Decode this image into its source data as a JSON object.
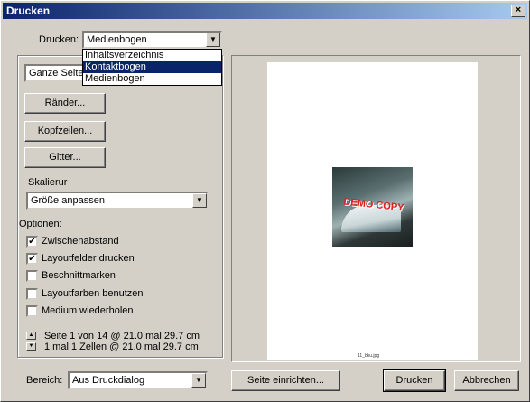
{
  "window": {
    "title": "Drucken",
    "close": "×"
  },
  "printer": {
    "label": "Drucken:",
    "value": "Medienbogen",
    "options": [
      "Inhaltsverzeichnis",
      "Kontaktbogen",
      "Medienbogen"
    ],
    "highlighted": "Kontaktbogen"
  },
  "page_mode": {
    "value": "Ganze Seite"
  },
  "buttons": {
    "margins": "Ränder...",
    "headers": "Kopfzeilen...",
    "grid": "Gitter...",
    "page_setup": "Seite einrichten...",
    "print": "Drucken",
    "cancel": "Abbrechen"
  },
  "scaling": {
    "label": "Skalierur",
    "value": "Größe anpassen"
  },
  "options": {
    "label": "Optionen:",
    "items": [
      {
        "label": "Zwischenabstand",
        "checked": true
      },
      {
        "label": "Layoutfelder drucken",
        "checked": true
      },
      {
        "label": "Beschnittmarken",
        "checked": false
      },
      {
        "label": "Layoutfarben benutzen",
        "checked": false
      },
      {
        "label": "Medium wiederholen",
        "checked": false
      }
    ]
  },
  "status": {
    "line1": "Seite 1 von 14 @ 21.0 mal 29.7 cm",
    "line2": "1 mal 1 Zellen @ 21.0 mal 29.7 cm"
  },
  "range": {
    "label": "Bereich:",
    "value": "Aus Druckdialog"
  },
  "preview": {
    "watermark": "DEMO COPY",
    "caption": "11_bku.jpg"
  },
  "icons": {
    "check": "✔",
    "dropdown_arrow": "▼",
    "spin_up": "▲",
    "spin_down": "▼"
  }
}
